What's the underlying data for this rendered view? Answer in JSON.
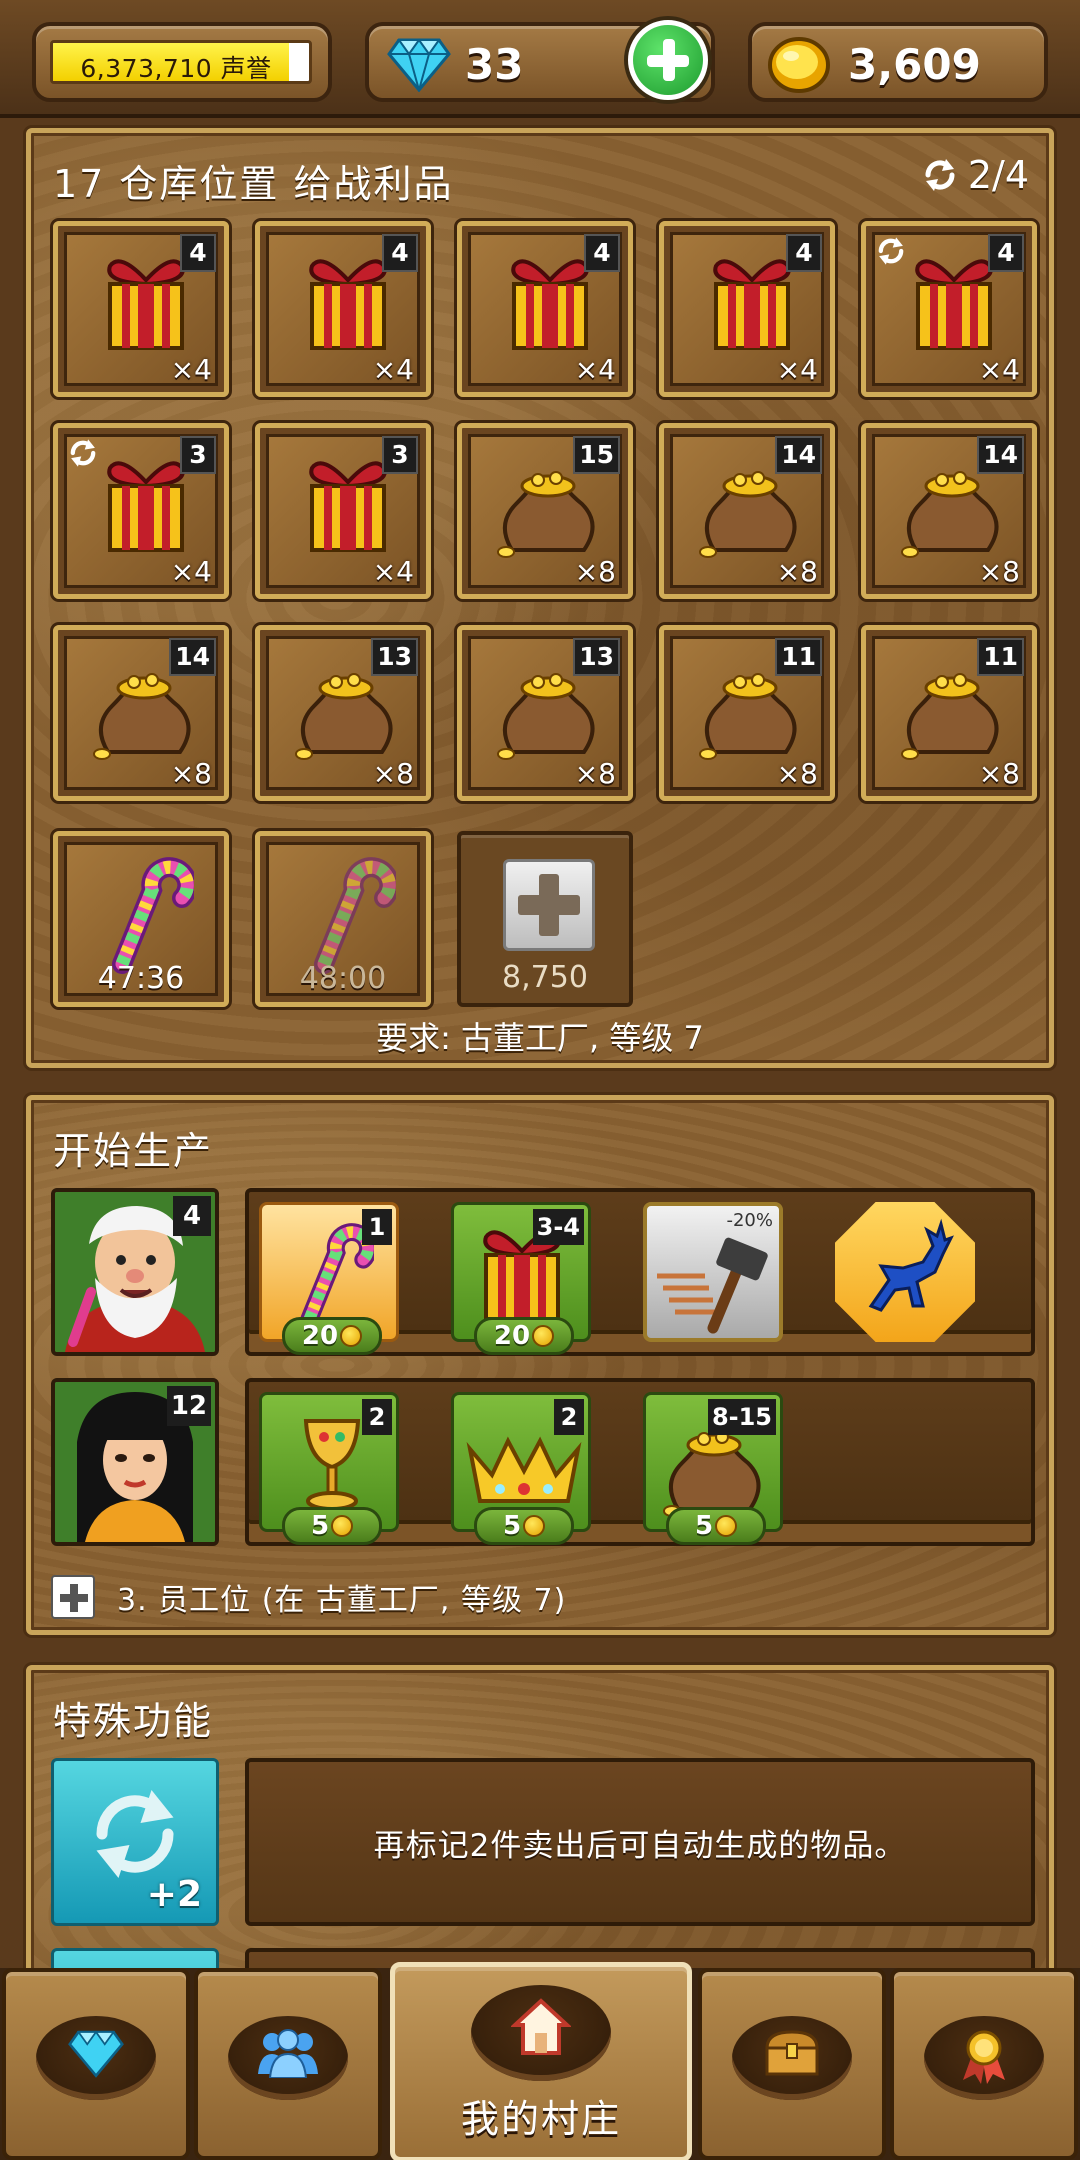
{
  "topbar": {
    "reputation_text": "6,373,710 声誉",
    "reputation_fill": 0.92,
    "gems": "33",
    "gold": "3,609"
  },
  "storage": {
    "title": "17 仓库位置 给战利品",
    "refresh_counter": "2/4",
    "slots": [
      {
        "item": "gift-icon",
        "badge": "4",
        "count": "×4",
        "auto": false
      },
      {
        "item": "gift-icon",
        "badge": "4",
        "count": "×4",
        "auto": false
      },
      {
        "item": "gift-icon",
        "badge": "4",
        "count": "×4",
        "auto": false
      },
      {
        "item": "gift-icon",
        "badge": "4",
        "count": "×4",
        "auto": false
      },
      {
        "item": "gift-icon",
        "badge": "4",
        "count": "×4",
        "auto": true
      },
      {
        "item": "gift-icon",
        "badge": "3",
        "count": "×4",
        "auto": true
      },
      {
        "item": "gift-icon",
        "badge": "3",
        "count": "×4",
        "auto": false
      },
      {
        "item": "gold-sack-icon",
        "badge": "15",
        "count": "×8",
        "auto": false
      },
      {
        "item": "gold-sack-icon",
        "badge": "14",
        "count": "×8",
        "auto": false
      },
      {
        "item": "gold-sack-icon",
        "badge": "14",
        "count": "×8",
        "auto": false
      },
      {
        "item": "gold-sack-icon",
        "badge": "14",
        "count": "×8",
        "auto": false
      },
      {
        "item": "gold-sack-icon",
        "badge": "13",
        "count": "×8",
        "auto": false
      },
      {
        "item": "gold-sack-icon",
        "badge": "13",
        "count": "×8",
        "auto": false
      },
      {
        "item": "gold-sack-icon",
        "badge": "11",
        "count": "×8",
        "auto": false
      },
      {
        "item": "gold-sack-icon",
        "badge": "11",
        "count": "×8",
        "auto": false
      }
    ],
    "timer_slots": [
      {
        "item": "candy-cane-icon",
        "timer": "47:36"
      },
      {
        "item": "candy-cane-icon",
        "timer": "48:00"
      }
    ],
    "add_slot_price": "8,750",
    "requirement": "要求: 古董工厂, 等级 7"
  },
  "production": {
    "title": "开始生产",
    "workers": [
      {
        "name": "santa-worker",
        "level": "4",
        "products": [
          {
            "icon": "candy-cane-icon",
            "badge": "1",
            "cost": "20",
            "style": "orange"
          },
          {
            "icon": "gift-icon",
            "badge": "3-4",
            "cost": "20",
            "style": "green"
          }
        ],
        "boost_label": "-20%"
      },
      {
        "name": "lady-worker",
        "level": "12",
        "products": [
          {
            "icon": "goblet-icon",
            "badge": "2",
            "cost": "5",
            "style": "green"
          },
          {
            "icon": "crown-icon",
            "badge": "2",
            "cost": "5",
            "style": "green"
          },
          {
            "icon": "gold-sack-icon",
            "badge": "8-15",
            "cost": "5",
            "style": "green"
          }
        ]
      }
    ],
    "employee_slot_text": "3. 员工位 (在 古董工厂, 等级 7)"
  },
  "special": {
    "title": "特殊功能",
    "feature_badge": "+2",
    "feature_desc": "再标记2件卖出后可自动生成的物品。"
  },
  "nav": {
    "tabs": [
      {
        "icon": "diamond-icon"
      },
      {
        "icon": "people-icon"
      },
      {
        "icon": "home-icon",
        "label": "我的村庄"
      },
      {
        "icon": "treasure-chest-icon"
      },
      {
        "icon": "medal-icon"
      }
    ]
  },
  "colors": {
    "wood": "#8a6232",
    "frame": "#c9a45a",
    "gold": "#f3d000",
    "green": "#4e8f1d"
  }
}
